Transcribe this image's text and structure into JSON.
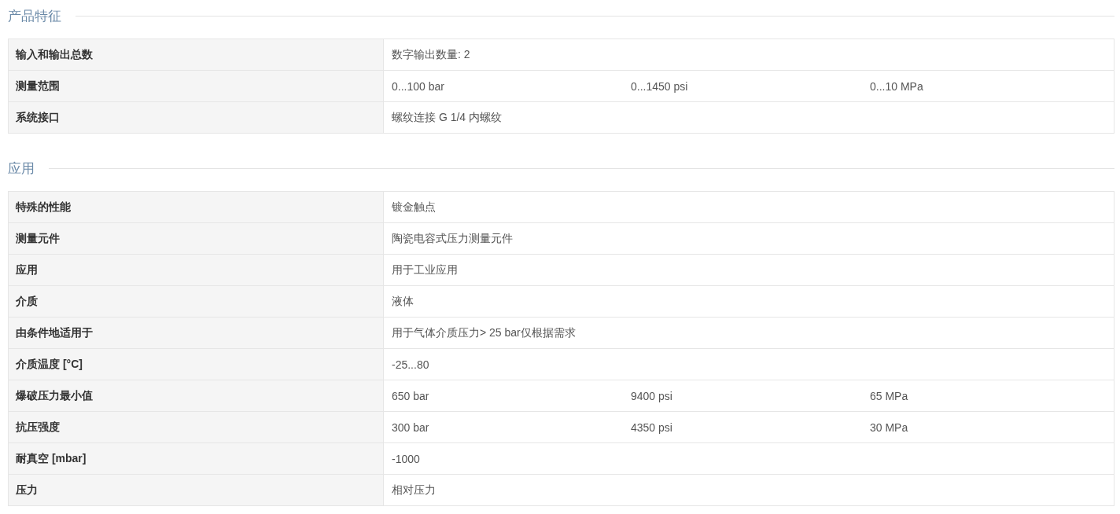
{
  "sections": [
    {
      "title": "产品特征",
      "rows": [
        {
          "label": "输入和输出总数",
          "values": [
            "数字输出数量: 2"
          ]
        },
        {
          "label": "测量范围",
          "values": [
            "0...100 bar",
            "0...1450 psi",
            "0...10 MPa"
          ]
        },
        {
          "label": "系统接口",
          "values": [
            "螺纹连接 G 1/4 内螺纹"
          ]
        }
      ]
    },
    {
      "title": "应用",
      "rows": [
        {
          "label": "特殊的性能",
          "values": [
            "镀金触点"
          ]
        },
        {
          "label": "测量元件",
          "values": [
            "陶瓷电容式压力测量元件"
          ]
        },
        {
          "label": "应用",
          "values": [
            "用于工业应用"
          ]
        },
        {
          "label": "介质",
          "values": [
            "液体"
          ]
        },
        {
          "label": "由条件地适用于",
          "values": [
            "用于气体介质压力> 25 bar仅根据需求"
          ]
        },
        {
          "label": "介质温度 [°C]",
          "values": [
            "-25...80"
          ]
        },
        {
          "label": "爆破压力最小值",
          "values": [
            "650 bar",
            "9400 psi",
            "65 MPa"
          ]
        },
        {
          "label": "抗压强度",
          "values": [
            "300 bar",
            "4350 psi",
            "30 MPa"
          ]
        },
        {
          "label": "耐真空 [mbar]",
          "values": [
            "-1000"
          ]
        },
        {
          "label": "压力",
          "values": [
            "相对压力"
          ]
        }
      ]
    }
  ]
}
